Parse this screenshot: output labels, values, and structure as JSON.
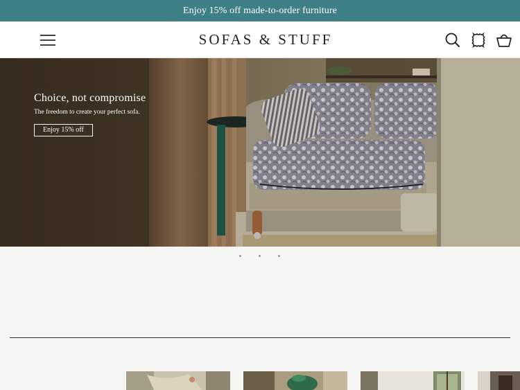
{
  "promo": {
    "text": "Enjoy 15% off made-to-order furniture"
  },
  "header": {
    "logo": "SOFAS & STUFF",
    "menu_icon": "hamburger-menu-icon",
    "icons": [
      "search-icon",
      "fabric-swatch-icon",
      "basket-icon"
    ]
  },
  "hero": {
    "title": "Choice, not compromise",
    "subtitle": "The freedom to create your perfect sofa.",
    "cta": "Enjoy 15% off",
    "image": "floral-upholstered-sofa-in-living-room"
  },
  "carousel": {
    "slide_count": 3,
    "active_index": 0
  },
  "thumbnails": [
    "fabric-swatches-image",
    "green-ceramic-vase-image",
    "interior-window-image",
    "interior-dark-image"
  ],
  "colors": {
    "promo_bg": "#3f7f88",
    "header_bg": "#ffffff",
    "page_bg": "#f5f5f4"
  }
}
